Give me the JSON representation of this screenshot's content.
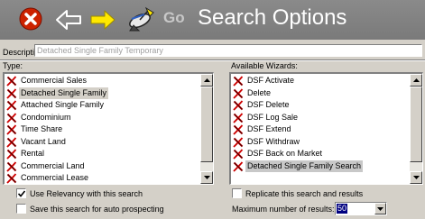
{
  "toolbar": {
    "close_icon": "close-icon",
    "back_icon": "back-arrow-icon",
    "forward_icon": "forward-arrow-icon",
    "search_icon": "satellite-dish-search-icon",
    "go_label": "Go",
    "title": "Search Options"
  },
  "description": {
    "label": "Description:",
    "value": "Detached Single Family Temporary"
  },
  "type_list": {
    "label": "Type:",
    "items": [
      {
        "label": "Commercial Sales"
      },
      {
        "label": "Detached Single Family",
        "selected": true
      },
      {
        "label": "Attached Single Family"
      },
      {
        "label": "Condominium"
      },
      {
        "label": "Time Share"
      },
      {
        "label": "Vacant Land"
      },
      {
        "label": "Rental"
      },
      {
        "label": "Commercial Land"
      },
      {
        "label": "Commercial Lease"
      }
    ]
  },
  "wizards_list": {
    "label": "Available Wizards:",
    "items": [
      {
        "label": "DSF Activate"
      },
      {
        "label": "Delete"
      },
      {
        "label": "DSF Delete"
      },
      {
        "label": "DSF Log Sale"
      },
      {
        "label": "DSF Extend"
      },
      {
        "label": "DSF Withdraw"
      },
      {
        "label": "DSF Back on Market"
      },
      {
        "label": "Detached Single Family Search",
        "selected": true
      }
    ]
  },
  "options": {
    "use_relevancy": {
      "label": "Use Relevancy with this search",
      "checked": true
    },
    "save_auto_prospecting": {
      "label": "Save this search for auto prospecting",
      "checked": false
    },
    "replicate": {
      "label": "Replicate this search and results",
      "checked": false
    },
    "max_results": {
      "label": "Maximum number of results:",
      "value": "50"
    }
  },
  "colors": {
    "title_bar": "#808080",
    "window_bg": "#d4d0c8",
    "close_red": "#cc2200",
    "arrow_yellow": "#ffe800",
    "x_mark_red": "#cc0000",
    "selection_blue": "#000080"
  }
}
